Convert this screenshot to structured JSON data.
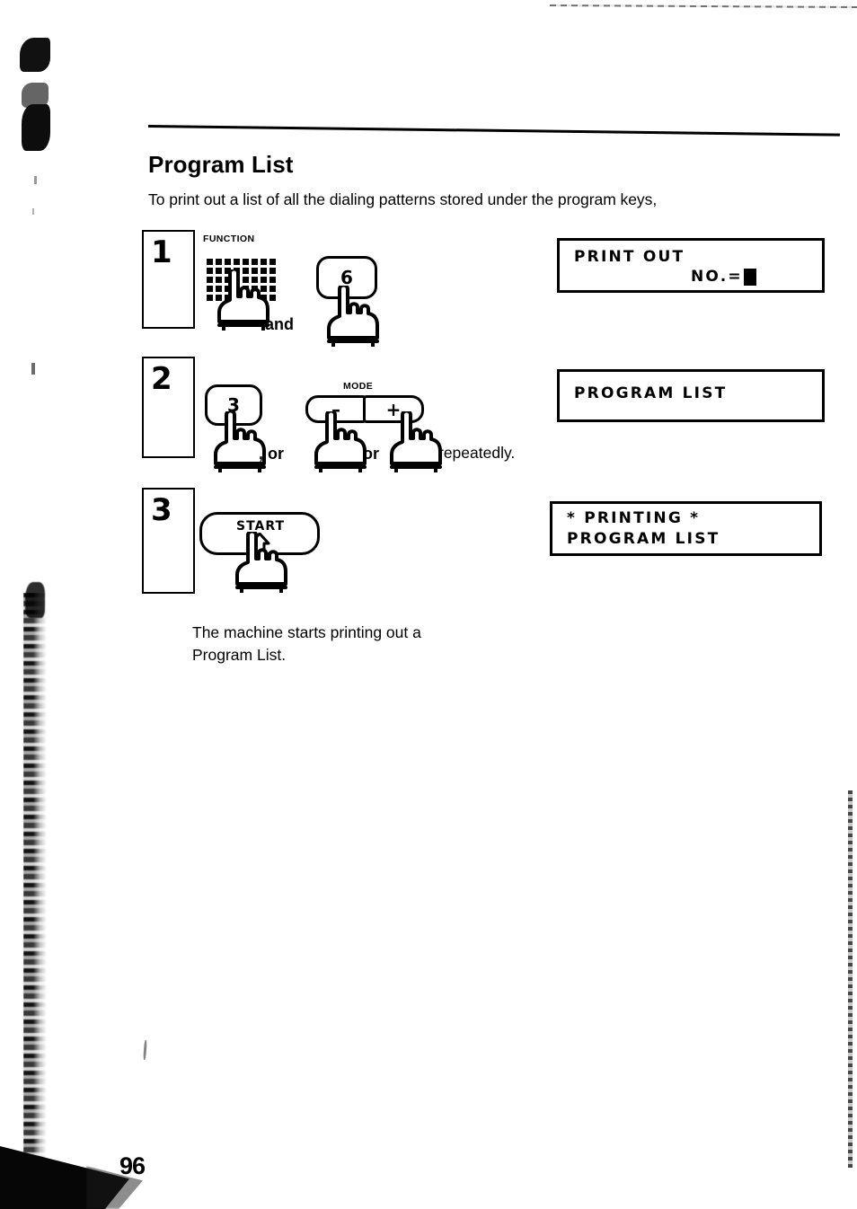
{
  "document": {
    "title": "Program List",
    "intro": "To print out a list of all the dialing patterns stored under the program keys,",
    "closing_line1": "The machine starts printing out a",
    "closing_line2": "Program List.",
    "page_number": "96"
  },
  "steps": [
    {
      "number": "1",
      "key_label": "FUNCTION",
      "keypad_icon": "dot-matrix-keypad-icon",
      "conjunction": "and",
      "second_key": "6",
      "display": {
        "line1": "PRINT OUT",
        "line2": "NO.=",
        "cursor": "block-cursor"
      }
    },
    {
      "number": "2",
      "first_key": "3",
      "conjunction1": ", or",
      "mode_label": "MODE",
      "mode_minus": "–",
      "mode_plus": "+",
      "conjunction2": "or",
      "trailing_text": "repeatedly.",
      "display": {
        "line1": "PROGRAM LIST"
      }
    },
    {
      "number": "3",
      "start_key": "START",
      "start_icon": "up-arrow-icon",
      "display": {
        "line1": "* PRINTING *",
        "line2": "PROGRAM LIST"
      }
    }
  ],
  "colors": {
    "ink": "#000000",
    "paper": "#ffffff"
  }
}
